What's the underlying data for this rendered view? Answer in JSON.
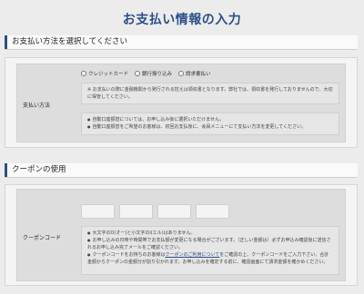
{
  "page": {
    "title": "お支払い情報の入力"
  },
  "payment": {
    "heading": "お支払い方法を選択してください",
    "row_label": "支払い方法",
    "options": [
      "クレジットカード",
      "銀行振り込み",
      "請求書払い"
    ],
    "note": "※ お支払いの際に金融機関から発行される控えは領収書となります。弊社では、領収書を発行しておりませんので、大切に保管してください。",
    "bullets": [
      "自動口座振替については、お申し込み後に選択いただけません。",
      "自動口座振替をご希望のお客様は、初回お支払後に、会員メニューにて支払い方法を変更してください。"
    ]
  },
  "coupon": {
    "heading": "クーポンの使用",
    "row_label": "クーポンコード",
    "bullets": [
      "大文字のO(オー)と小文字のl(エル)はありません。",
      "お申し込みの日時や時間帯でお支払額が変更になる場合がございます。（正しい金額は）必ずお申込み確認後に送信されるお申し込み完了メールをご確認ください。",
      "クーポンコードをお持ちのお客様は",
      "クーポンのご利用について",
      "をご確認の上、クーポンコードをご入力下さい。合計金額からクーポンの金額分が割り引かれます。お申し込みを確定する前に、確認画面にて請求金額を確かめください。"
    ]
  }
}
